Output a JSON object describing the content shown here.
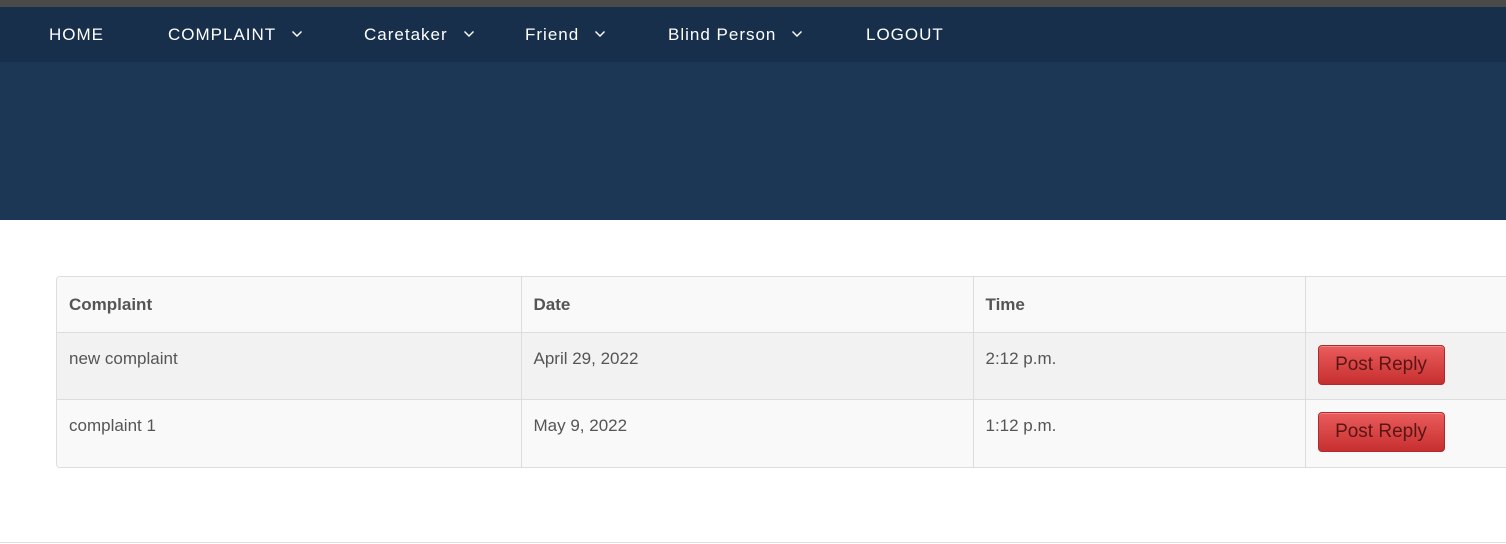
{
  "nav": {
    "items": [
      {
        "label": "HOME",
        "dropdown": false
      },
      {
        "label": "COMPLAINT",
        "dropdown": true
      },
      {
        "label": "Caretaker",
        "dropdown": true
      },
      {
        "label": "Friend",
        "dropdown": true
      },
      {
        "label": "Blind Person",
        "dropdown": true
      },
      {
        "label": "LOGOUT",
        "dropdown": false
      }
    ],
    "caret_icon": "chevron-down-icon"
  },
  "table": {
    "headers": [
      "Complaint",
      "Date",
      "Time",
      ""
    ],
    "rows": [
      {
        "complaint": "new complaint",
        "date": "April 29, 2022",
        "time": "2:12 p.m.",
        "action": "Post Reply"
      },
      {
        "complaint": "complaint 1",
        "date": "May 9, 2022",
        "time": "1:12 p.m.",
        "action": "Post Reply"
      }
    ]
  },
  "colors": {
    "navbar": "#172f4b",
    "hero": "#1c3655",
    "button": "#d9413f"
  }
}
